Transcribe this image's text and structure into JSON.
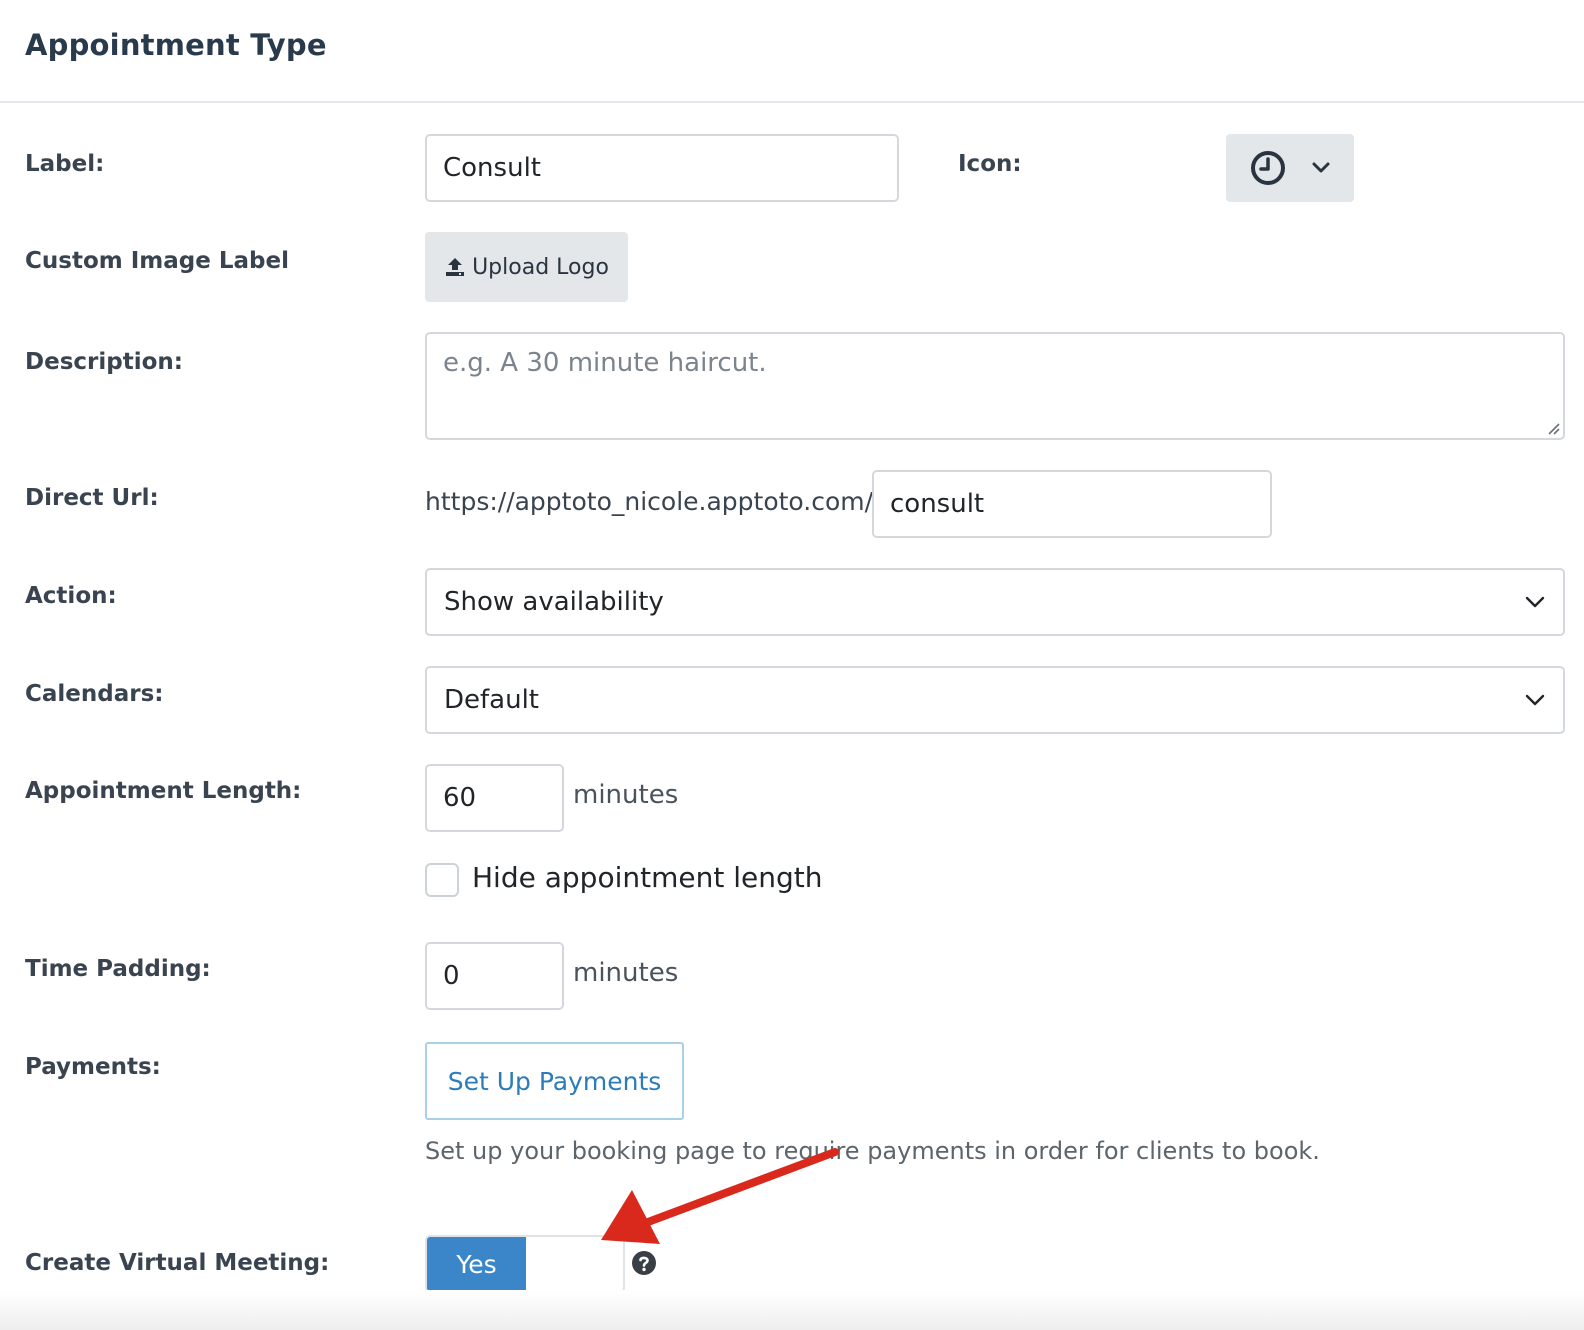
{
  "header": {
    "title": "Appointment Type"
  },
  "form": {
    "label": {
      "label": "Label:",
      "value": "Consult"
    },
    "icon": {
      "label": "Icon:",
      "selected_icon": "clock-icon"
    },
    "custom_image": {
      "label": "Custom Image Label",
      "button": "Upload Logo"
    },
    "description": {
      "label": "Description:",
      "value": "",
      "placeholder": "e.g. A 30 minute haircut."
    },
    "direct_url": {
      "label": "Direct Url:",
      "prefix": "https://apptoto_nicole.apptoto.com/",
      "value": "consult"
    },
    "action": {
      "label": "Action:",
      "selected": "Show availability"
    },
    "calendars": {
      "label": "Calendars:",
      "selected": "Default"
    },
    "appointment_length": {
      "label": "Appointment Length:",
      "value": "60",
      "suffix": "minutes",
      "hide_label": "Hide appointment length",
      "hide_checked": false
    },
    "time_padding": {
      "label": "Time Padding:",
      "value": "0",
      "suffix": "minutes"
    },
    "payments": {
      "label": "Payments:",
      "button": "Set Up Payments",
      "help": "Set up your booking page to require payments in order for clients to book."
    },
    "virtual_meeting": {
      "label": "Create Virtual Meeting:",
      "toggle_on_label": "Yes",
      "state": "on"
    }
  },
  "colors": {
    "title": "#2a3a4d",
    "primary": "#3b86c9",
    "link": "#2b7cb8",
    "annotation_arrow": "#d9291c",
    "control_gray": "#e4e7ea"
  }
}
